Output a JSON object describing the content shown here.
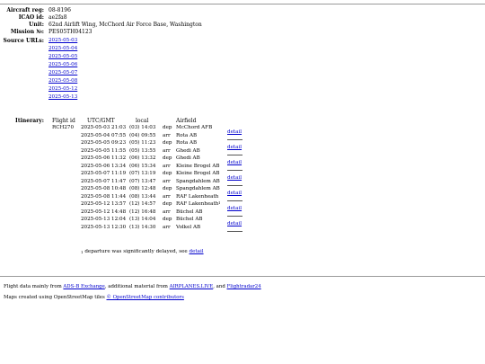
{
  "aircraft": [
    {
      "label": "Aircraft reg:",
      "value": "08-8196"
    },
    {
      "label": "ICAO id:",
      "value": "ae2fa8"
    },
    {
      "label": "Unit:",
      "value": "62nd Airlift Wing, McChord Air Force Base, Washington"
    },
    {
      "label": "Mission №:",
      "value": "PES05TH04123"
    }
  ],
  "source_urls_label": "Source URLs:",
  "source_urls": [
    "2025-05-03",
    "2025-05-04",
    "2025-05-05",
    "2025-05-06",
    "2025-05-07",
    "2025-05-08",
    "2025-05-12",
    "2025-05-13"
  ],
  "itinerary_label": "Itinerary:",
  "itinerary_headers": {
    "flight": "Flight id",
    "utc": "UTC/GMT",
    "local": "local",
    "airfield": "Airfield"
  },
  "flight_id": "RCH270",
  "rows": [
    {
      "utc": "2025-05-03 21:03",
      "local": "(03) 14:03",
      "dir": "dep",
      "airfield": "McChord AFB",
      "note": ""
    },
    {
      "utc": "2025-05-04 07:55",
      "local": "(04) 09:55",
      "dir": "arr",
      "airfield": "Rota AB",
      "note": ""
    },
    {
      "utc": "2025-05-05 09:23",
      "local": "(05) 11:23",
      "dir": "dep",
      "airfield": "Rota AB",
      "note": ""
    },
    {
      "utc": "2025-05-05 11:55",
      "local": "(05) 13:55",
      "dir": "arr",
      "airfield": "Ghedi AB",
      "note": ""
    },
    {
      "utc": "2025-05-06 11:32",
      "local": "(06) 13:32",
      "dir": "dep",
      "airfield": "Ghedi AB",
      "note": ""
    },
    {
      "utc": "2025-05-06 13:34",
      "local": "(06) 15:34",
      "dir": "arr",
      "airfield": "Kleine Brogel AB",
      "note": ""
    },
    {
      "utc": "2025-05-07 11:19",
      "local": "(07) 13:19",
      "dir": "dep",
      "airfield": "Kleine Brogel AB",
      "note": ""
    },
    {
      "utc": "2025-05-07 11:47",
      "local": "(07) 13:47",
      "dir": "arr",
      "airfield": "Spangdahlem AB",
      "note": ""
    },
    {
      "utc": "2025-05-08 10:48",
      "local": "(08) 12:48",
      "dir": "dep",
      "airfield": "Spangdahlem AB",
      "note": ""
    },
    {
      "utc": "2025-05-08 11:44",
      "local": "(08) 13:44",
      "dir": "arr",
      "airfield": "RAF Lakenheath",
      "note": ""
    },
    {
      "utc": "2025-05-12 13:57",
      "local": "(12) 14:57",
      "dir": "dep",
      "airfield": "RAF Lakenheath",
      "note": "1"
    },
    {
      "utc": "2025-05-12 14:48",
      "local": "(12) 16:48",
      "dir": "arr",
      "airfield": "Büchel AB",
      "note": ""
    },
    {
      "utc": "2025-05-13 12:04",
      "local": "(13) 14:04",
      "dir": "dep",
      "airfield": "Büchel AB",
      "note": ""
    },
    {
      "utc": "2025-05-13 12:30",
      "local": "(13) 14:30",
      "dir": "arr",
      "airfield": "Volkel AB",
      "note": ""
    }
  ],
  "detail_label": "detail",
  "footnote": {
    "mark": "1",
    "text": "departure was significantly delayed, see ",
    "link": "detail"
  },
  "footer": {
    "line1_a": "Flight data mainly from ",
    "link_adsb": "ADS-B Exchange",
    "line1_b": ", additional material from ",
    "link_airplanes": "AIRPLANES.LIVE",
    "line1_c": ", and ",
    "link_fr24": "Flightradar24",
    "line2_a": "Maps created using OpenStreetMap tiles ",
    "link_osm": "© OpenStreetMap contributors"
  }
}
